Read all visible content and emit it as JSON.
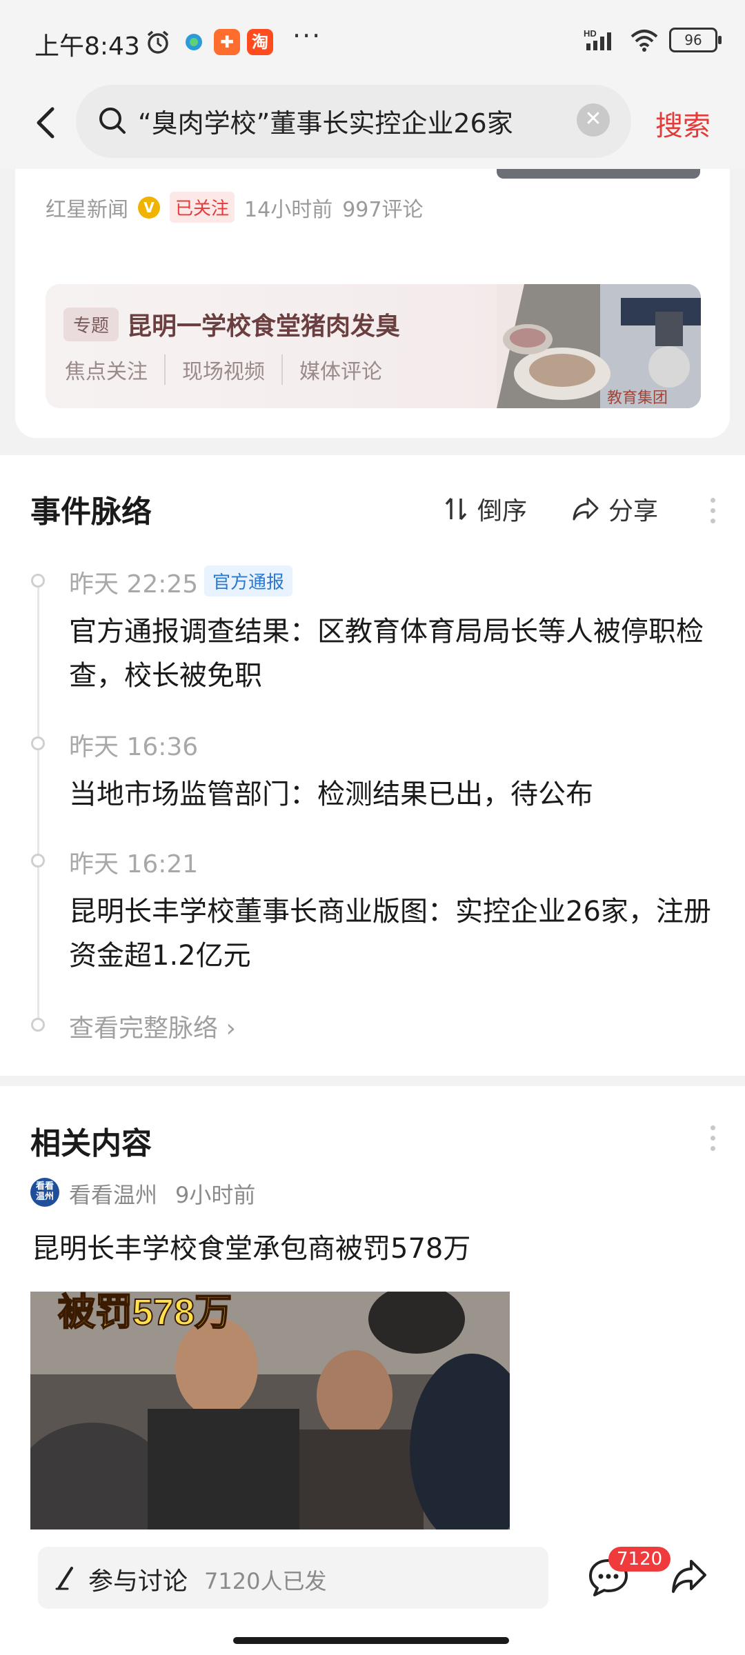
{
  "status_bar": {
    "time": "上午8:43",
    "app_icon_1": "淘",
    "dots": "···",
    "network": "HD",
    "battery": "96"
  },
  "search": {
    "query": "“臭肉学校”董事长实控企业26家",
    "button": "搜索"
  },
  "article": {
    "source": "红星新闻",
    "follow_state": "已关注",
    "time": "14小时前",
    "comments": "997评论"
  },
  "topic": {
    "tag": "专题",
    "title": "昆明一学校食堂猪肉发臭",
    "links": [
      "焦点关注",
      "现场视频",
      "媒体评论"
    ],
    "image_caption": "教育集团"
  },
  "timeline": {
    "title": "事件脉络",
    "sort_label": "倒序",
    "share_label": "分享",
    "items": [
      {
        "time": "昨天 22:25",
        "badge": "官方通报",
        "text": "官方通报调查结果：区教育体育局局长等人被停职检查，校长被免职"
      },
      {
        "time": "昨天 16:36",
        "text": "当地市场监管部门：检测结果已出，待公布"
      },
      {
        "time": "昨天 16:21",
        "text": "昆明长丰学校董事长商业版图：实控企业26家，注册资金超1.2亿元"
      }
    ],
    "more": "查看完整脉络 ›"
  },
  "related": {
    "title": "相关内容",
    "avatar_text": "看看 温州",
    "source": "看看温州",
    "time": "9小时前",
    "headline": "昆明长丰学校食堂承包商被罚578万",
    "image_caption": "被罚578万"
  },
  "bottom_bar": {
    "discuss_label": "参与讨论",
    "discuss_count": "7120人已发",
    "comment_badge": "7120"
  }
}
